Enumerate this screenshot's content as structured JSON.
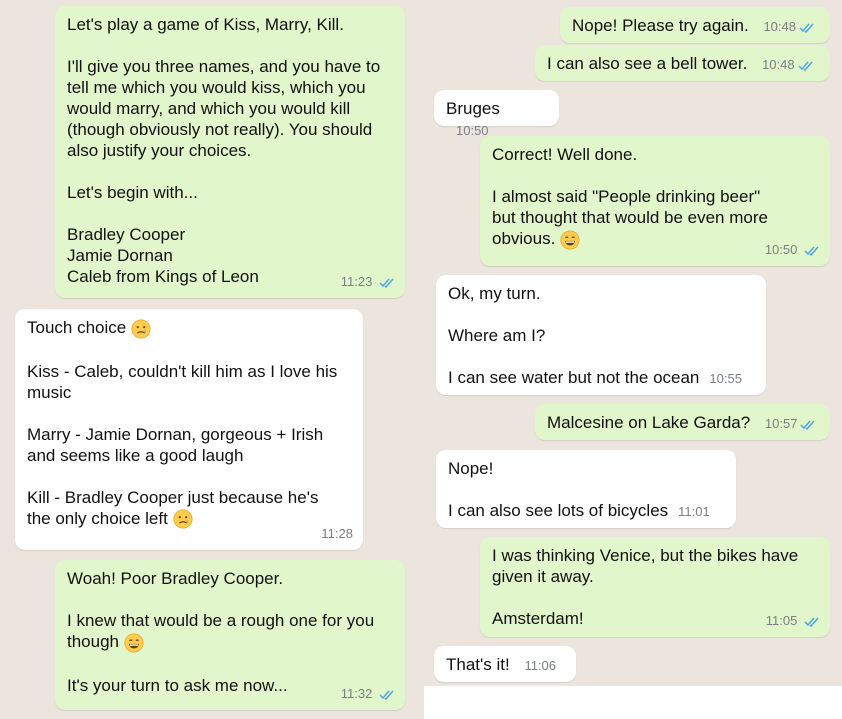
{
  "left": {
    "b1": {
      "paras": [
        [
          "Let's play a game of Kiss, Marry, Kill."
        ],
        [
          "I'll give you three names, and you have to",
          "tell me which you would kiss, which you",
          "would marry, and which you would kill",
          "(though obviously not really). You should",
          "also justify your choices."
        ],
        [
          "Let's begin with..."
        ],
        [
          "Bradley Cooper",
          "Jamie Dornan",
          "Caleb from Kings of Leon"
        ]
      ],
      "time": "11:23"
    },
    "b2": {
      "p1": "Touch choice",
      "p2": [
        "Kiss - Caleb, couldn't kill him as I love his",
        "music"
      ],
      "p3": [
        "Marry - Jamie Dornan, gorgeous + Irish",
        "and seems like a good laugh"
      ],
      "p4a": "Kill - Bradley Cooper just because he's",
      "p4b": "the only choice left",
      "time": "11:28"
    },
    "b3": {
      "p1": "Woah! Poor Bradley Cooper.",
      "p2a": "I knew that would be a rough one for you",
      "p2b": "though",
      "p3": "It's your turn to ask me now...",
      "time": "11:32"
    }
  },
  "right": {
    "r1": {
      "text": "Nope! Please try again.",
      "time": "10:48"
    },
    "r2": {
      "text": "I can also see a bell tower.",
      "time": "10:48"
    },
    "r3": {
      "text": "Bruges",
      "time": "10:50"
    },
    "r4": {
      "p1": "Correct! Well done.",
      "p2a": "I almost said \"People drinking beer\"",
      "p2b": "but thought that would be even more",
      "p2c": "obvious.",
      "time": "10:50"
    },
    "r5": {
      "p1": "Ok, my turn.",
      "p2": "Where am I?",
      "p3": "I can see water but not the ocean",
      "time": "10:55"
    },
    "r6": {
      "text": "Malcesine on Lake Garda?",
      "time": "10:57"
    },
    "r7": {
      "p1": "Nope!",
      "p2": "I can also see lots of bicycles",
      "time": "11:01"
    },
    "r8": {
      "p1a": "I was thinking Venice, but the bikes have",
      "p1b": "given it away.",
      "p2": "Amsterdam!",
      "time": "11:05"
    },
    "r9": {
      "text": "That's it!",
      "time": "11:06"
    }
  },
  "icons": {
    "read_receipt": "double-check-icon",
    "emoji_cry": "sad-tear-emoji-icon",
    "emoji_grin": "grinning-emoji-icon"
  },
  "colors": {
    "chat_background": "#ece5dd",
    "outgoing_bubble": "#e1f6cb",
    "incoming_bubble": "#ffffff",
    "read_tick": "#4fa3e0",
    "timestamp": "#7a7f84"
  }
}
